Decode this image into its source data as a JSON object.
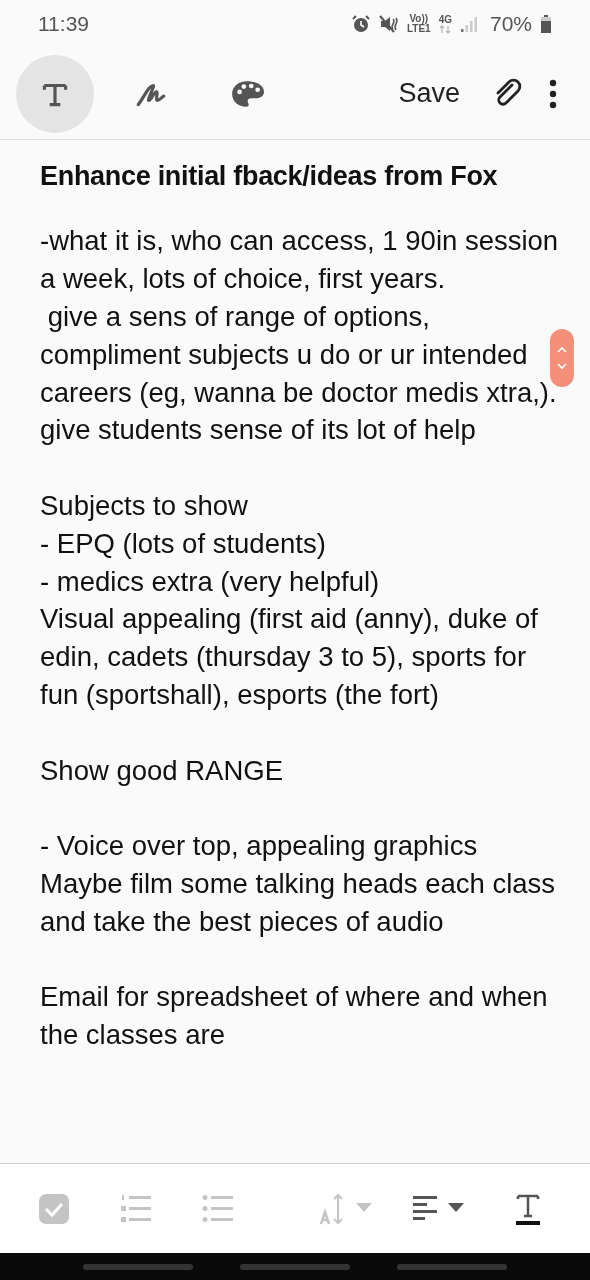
{
  "status_bar": {
    "time": "11:39",
    "volte": "Vo))",
    "lte": "LTE1",
    "network": "4G",
    "battery": "70%"
  },
  "toolbar": {
    "modes": [
      {
        "kind": "text",
        "selected": true
      },
      {
        "kind": "pen",
        "selected": false
      },
      {
        "kind": "palette",
        "selected": false
      }
    ],
    "save": "Save"
  },
  "note": {
    "title": "Enhance initial fback/ideas from Fox",
    "blocks": [
      [
        "-what it is, who can access, 1 90in session a week, lots of choice, first years.",
        " give a sens of range of options, compliment subjects u do or ur intended careers (eg, wanna be doctor medis xtra,).",
        "give students sense of its lot of help"
      ],
      [
        "Subjects to show",
        "- EPQ (lots of students)",
        "- medics extra (very helpful)",
        "Visual appealing (first aid (anny), duke of edin, cadets (thursday 3 to 5), sports for fun (sportshall), esports (the fort)"
      ],
      [
        "Show good RANGE"
      ],
      [
        "- Voice over top, appealing graphics",
        "Maybe film some talking heads each class and take the best pieces of audio"
      ],
      [
        "Email for spreadsheet of where and when the classes are"
      ]
    ]
  },
  "format_bar": [
    {
      "kind": "checkbox",
      "disabled": true
    },
    {
      "kind": "numbered",
      "disabled": true
    },
    {
      "kind": "bullets",
      "disabled": true
    },
    {
      "kind": "size",
      "disabled": true
    },
    {
      "kind": "align",
      "disabled": false
    },
    {
      "kind": "style",
      "disabled": false
    }
  ]
}
